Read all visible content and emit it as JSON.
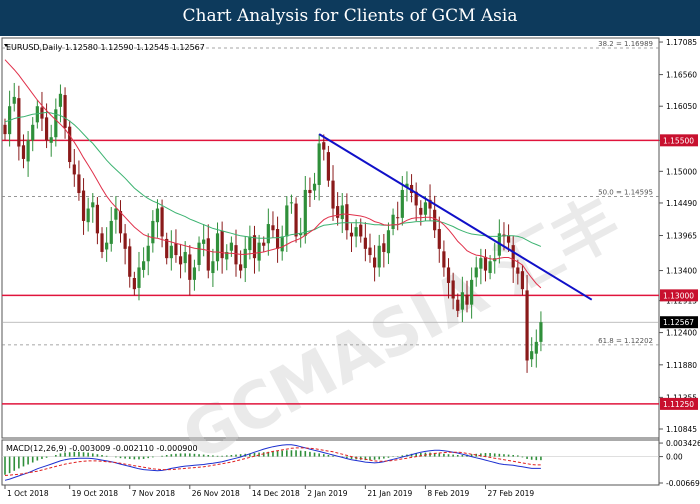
{
  "header": {
    "title": "Chart Analysis for Clients of GCM Asia"
  },
  "chart_data": {
    "type": "candlestick",
    "symbol_info": "EURUSD,Daily  1.12580 1.12590 1.12545 1.12567",
    "price_axis": {
      "ylim": [
        1.107,
        1.1715
      ],
      "ticks": [
        "1.17085",
        "1.16560",
        "1.16050",
        "1.15500",
        "1.15000",
        "1.14490",
        "1.13965",
        "1.13400",
        "1.12915",
        "1.12400",
        "1.11880",
        "1.11355",
        "1.10845"
      ]
    },
    "x_axis": {
      "labels": [
        {
          "label": "1 Oct 2018",
          "bar": 0
        },
        {
          "label": "19 Oct 2018",
          "bar": 14
        },
        {
          "label": "7 Nov 2018",
          "bar": 27
        },
        {
          "label": "26 Nov 2018",
          "bar": 40
        },
        {
          "label": "14 Dec 2018",
          "bar": 53
        },
        {
          "label": "2 Jan 2019",
          "bar": 65
        },
        {
          "label": "21 Jan 2019",
          "bar": 78
        },
        {
          "label": "8 Feb 2019",
          "bar": 91
        },
        {
          "label": "27 Feb 2019",
          "bar": 104
        }
      ]
    },
    "fib_levels": [
      {
        "label": "38.2 = 1.16989",
        "price": 1.16989
      },
      {
        "label": "50.0 = 1.14595",
        "price": 1.14595
      },
      {
        "label": "61.8 = 1.12202",
        "price": 1.12202
      }
    ],
    "horizontal_levels": [
      {
        "label": "1.15500",
        "price": 1.155
      },
      {
        "label": "1.13000",
        "price": 1.13
      },
      {
        "label": "1.11250",
        "price": 1.1125
      }
    ],
    "current_price": {
      "label": "1.12567",
      "price": 1.12567
    },
    "trendline": {
      "from": {
        "bar": 68,
        "price": 1.156
      },
      "to": {
        "bar": 127,
        "price": 1.1293
      }
    },
    "close": [
      1.156,
      1.1605,
      1.162,
      1.154,
      1.152,
      1.155,
      1.1575,
      1.1605,
      1.1585,
      1.155,
      1.1555,
      1.16,
      1.1625,
      1.157,
      1.1515,
      1.1495,
      1.1465,
      1.142,
      1.144,
      1.145,
      1.14,
      1.137,
      1.1385,
      1.142,
      1.144,
      1.14,
      1.1375,
      1.133,
      1.131,
      1.1345,
      1.1355,
      1.138,
      1.142,
      1.144,
      1.1395,
      1.136,
      1.138,
      1.1365,
      1.135,
      1.137,
      1.1325,
      1.1345,
      1.1385,
      1.139,
      1.134,
      1.1355,
      1.14,
      1.136,
      1.137,
      1.1385,
      1.135,
      1.134,
      1.1375,
      1.1395,
      1.136,
      1.1385,
      1.138,
      1.1415,
      1.1405,
      1.1375,
      1.1395,
      1.1445,
      1.145,
      1.1395,
      1.14,
      1.147,
      1.1465,
      1.148,
      1.1545,
      1.1535,
      1.1485,
      1.144,
      1.1425,
      1.1445,
      1.1405,
      1.1395,
      1.141,
      1.1395,
      1.1375,
      1.1365,
      1.1345,
      1.138,
      1.137,
      1.1405,
      1.143,
      1.1425,
      1.147,
      1.148,
      1.1465,
      1.1445,
      1.143,
      1.145,
      1.144,
      1.1405,
      1.1375,
      1.1345,
      1.132,
      1.1295,
      1.1275,
      1.1305,
      1.1285,
      1.1325,
      1.1345,
      1.136,
      1.134,
      1.1355,
      1.136,
      1.14,
      1.1395,
      1.1385,
      1.1345,
      1.1335,
      1.131,
      1.1195,
      1.121,
      1.1225,
      1.12567
    ],
    "ma_red": [
      1.168,
      1.1672,
      1.1664,
      1.1655,
      1.1645,
      1.1635,
      1.1625,
      1.1615,
      1.1606,
      1.1598,
      1.159,
      1.1583,
      1.1576,
      1.1568,
      1.1558,
      1.1547,
      1.1535,
      1.1522,
      1.151,
      1.1498,
      1.1485,
      1.1472,
      1.146,
      1.145,
      1.1442,
      1.1434,
      1.1426,
      1.1418,
      1.141,
      1.1404,
      1.1398,
      1.1395,
      1.1393,
      1.1392,
      1.139,
      1.1388,
      1.1386,
      1.1384,
      1.1382,
      1.138,
      1.1378,
      1.1376,
      1.1375,
      1.1374,
      1.1372,
      1.137,
      1.137,
      1.1369,
      1.1368,
      1.1368,
      1.1367,
      1.1366,
      1.1366,
      1.1367,
      1.1368,
      1.1369,
      1.137,
      1.1372,
      1.1374,
      1.1376,
      1.1378,
      1.1382,
      1.1386,
      1.1389,
      1.1392,
      1.1397,
      1.1402,
      1.1407,
      1.1415,
      1.1422,
      1.1426,
      1.1428,
      1.1429,
      1.1431,
      1.1431,
      1.143,
      1.1429,
      1.1428,
      1.1426,
      1.1423,
      1.1419,
      1.1417,
      1.1414,
      1.1413,
      1.1414,
      1.1414,
      1.1417,
      1.1421,
      1.1424,
      1.1425,
      1.1425,
      1.1426,
      1.1426,
      1.1424,
      1.142,
      1.1414,
      1.1406,
      1.1397,
      1.1387,
      1.138,
      1.1372,
      1.1368,
      1.1365,
      1.1364,
      1.1361,
      1.1359,
      1.1358,
      1.136,
      1.1361,
      1.1361,
      1.1358,
      1.1354,
      1.1349,
      1.1338,
      1.1328,
      1.1319,
      1.1312
    ],
    "ma_green": [
      1.158,
      1.1582,
      1.1585,
      1.1587,
      1.1588,
      1.159,
      1.1592,
      1.1593,
      1.1594,
      1.1595,
      1.1594,
      1.1592,
      1.159,
      1.1586,
      1.1581,
      1.1575,
      1.1568,
      1.156,
      1.1552,
      1.1545,
      1.1536,
      1.1527,
      1.1518,
      1.151,
      1.1503,
      1.1496,
      1.1489,
      1.1481,
      1.1473,
      1.1467,
      1.1461,
      1.1456,
      1.1452,
      1.1449,
      1.1445,
      1.1441,
      1.1437,
      1.1433,
      1.143,
      1.1427,
      1.1423,
      1.142,
      1.1417,
      1.1414,
      1.1411,
      1.1408,
      1.1406,
      1.1404,
      1.1402,
      1.14,
      1.1398,
      1.1396,
      1.1395,
      1.1394,
      1.1393,
      1.1392,
      1.1392,
      1.1392,
      1.1393,
      1.1393,
      1.1394,
      1.1396,
      1.1398,
      1.1399,
      1.14,
      1.1402,
      1.1404,
      1.1406,
      1.141,
      1.1413,
      1.1414,
      1.1415,
      1.1416,
      1.1417,
      1.1417,
      1.1417,
      1.1417,
      1.1417,
      1.1416,
      1.1415,
      1.1414,
      1.1414,
      1.1413,
      1.1413,
      1.1414,
      1.1414,
      1.1416,
      1.1417,
      1.1418,
      1.1419,
      1.1419,
      1.142,
      1.142,
      1.142,
      1.1419,
      1.1417,
      1.1414,
      1.1411,
      1.1407,
      1.1404,
      1.1401,
      1.1399,
      1.1398,
      1.1397,
      1.1396,
      1.1395,
      1.1395,
      1.1395,
      1.1396,
      1.1396,
      1.1396,
      1.1395,
      1.1393,
      1.1389,
      1.1385,
      1.1382,
      1.1379
    ],
    "macd": {
      "label": "MACD(12,26,9) -0.003009 -0.002110 -0.000900",
      "ylim": [
        -0.0072,
        0.0042
      ],
      "ticks": [
        "0.003426",
        "0.00",
        "-0.006694"
      ],
      "histogram": [
        -0.0046,
        -0.0042,
        -0.0036,
        -0.003,
        -0.0025,
        -0.002,
        -0.0015,
        -0.001,
        -0.0006,
        -0.0003,
        0.0,
        0.0004,
        0.0008,
        0.001,
        0.0011,
        0.0012,
        0.0012,
        0.0011,
        0.001,
        0.0008,
        0.0006,
        0.0004,
        0.0002,
        0.0,
        -0.0002,
        -0.0004,
        -0.0005,
        -0.0006,
        -0.0007,
        -0.0007,
        -0.0006,
        -0.0004,
        -0.0002,
        0.0,
        0.0002,
        0.0004,
        0.0006,
        0.0007,
        0.0008,
        0.0008,
        0.0008,
        0.0007,
        0.0006,
        0.0005,
        0.0004,
        0.0003,
        0.0002,
        0.0002,
        0.0003,
        0.0004,
        0.0005,
        0.0006,
        0.0007,
        0.0008,
        0.0009,
        0.001,
        0.0011,
        0.0012,
        0.0013,
        0.0014,
        0.0015,
        0.0016,
        0.0016,
        0.0016,
        0.0015,
        0.0014,
        0.0012,
        0.001,
        0.0008,
        0.0006,
        0.0004,
        0.0002,
        0.0,
        -0.0002,
        -0.0004,
        -0.0006,
        -0.0007,
        -0.0008,
        -0.0009,
        -0.0009,
        -0.0008,
        -0.0007,
        -0.0005,
        -0.0003,
        -0.0001,
        0.0001,
        0.0003,
        0.0005,
        0.0007,
        0.0008,
        0.0009,
        0.001,
        0.001,
        0.0009,
        0.0008,
        0.0007,
        0.0006,
        0.0005,
        0.0004,
        0.0004,
        0.0005,
        0.0006,
        0.0007,
        0.0008,
        0.0009,
        0.0009,
        0.0008,
        0.0007,
        0.0006,
        0.0005,
        0.0004,
        0.0003,
        -0.0002,
        -0.0006,
        -0.0008,
        -0.0009,
        -0.0009
      ],
      "macd_line": [
        -0.006,
        -0.0057,
        -0.0053,
        -0.0049,
        -0.0045,
        -0.0041,
        -0.0036,
        -0.0031,
        -0.0027,
        -0.0023,
        -0.0019,
        -0.0015,
        -0.0011,
        -0.0008,
        -0.0006,
        -0.0005,
        -0.0004,
        -0.0004,
        -0.0004,
        -0.0005,
        -0.0007,
        -0.0009,
        -0.0011,
        -0.0013,
        -0.0016,
        -0.0019,
        -0.0022,
        -0.0025,
        -0.0028,
        -0.0031,
        -0.0033,
        -0.0034,
        -0.0035,
        -0.0036,
        -0.0035,
        -0.0033,
        -0.003,
        -0.0028,
        -0.0026,
        -0.0024,
        -0.0023,
        -0.0022,
        -0.0021,
        -0.002,
        -0.0018,
        -0.0017,
        -0.0015,
        -0.0013,
        -0.001,
        -0.0007,
        -0.0004,
        -0.0001,
        0.0003,
        0.0007,
        0.0011,
        0.0015,
        0.0019,
        0.0022,
        0.0025,
        0.0027,
        0.0029,
        0.003,
        0.003,
        0.0028,
        0.0025,
        0.0022,
        0.0019,
        0.0016,
        0.0013,
        0.001,
        0.0007,
        0.0004,
        0.0001,
        -0.0002,
        -0.0005,
        -0.0008,
        -0.001,
        -0.0012,
        -0.0014,
        -0.0015,
        -0.0016,
        -0.0015,
        -0.0013,
        -0.001,
        -0.0007,
        -0.0004,
        -0.0001,
        0.0002,
        0.0005,
        0.0008,
        0.0011,
        0.0013,
        0.0015,
        0.0016,
        0.0016,
        0.0015,
        0.0013,
        0.0011,
        0.0009,
        0.0006,
        0.0003,
        0.0,
        -0.0003,
        -0.0006,
        -0.0009,
        -0.0012,
        -0.0015,
        -0.0018,
        -0.002,
        -0.0021,
        -0.0022,
        -0.0024,
        -0.0026,
        -0.0028,
        -0.003,
        -0.003,
        -0.003
      ],
      "signal_line": [
        -0.0048,
        -0.0047,
        -0.0046,
        -0.0045,
        -0.0043,
        -0.0041,
        -0.0039,
        -0.0037,
        -0.0034,
        -0.0031,
        -0.0028,
        -0.0025,
        -0.0022,
        -0.0019,
        -0.0017,
        -0.0015,
        -0.0013,
        -0.0012,
        -0.0011,
        -0.0011,
        -0.0011,
        -0.0012,
        -0.0013,
        -0.0014,
        -0.0015,
        -0.0017,
        -0.0019,
        -0.0021,
        -0.0023,
        -0.0025,
        -0.0027,
        -0.0029,
        -0.0031,
        -0.0032,
        -0.0033,
        -0.0033,
        -0.0033,
        -0.0032,
        -0.0031,
        -0.003,
        -0.0029,
        -0.0028,
        -0.0027,
        -0.0026,
        -0.0024,
        -0.0022,
        -0.002,
        -0.0018,
        -0.0016,
        -0.0014,
        -0.0011,
        -0.0008,
        -0.0005,
        -0.0002,
        0.0001,
        0.0004,
        0.0007,
        0.001,
        0.0013,
        0.0015,
        0.0017,
        0.0019,
        0.0021,
        0.0022,
        0.0022,
        0.0022,
        0.0021,
        0.002,
        0.0018,
        0.0016,
        0.0014,
        0.0012,
        0.0009,
        0.0006,
        0.0003,
        0.0,
        -0.0003,
        -0.0005,
        -0.0007,
        -0.0009,
        -0.0011,
        -0.0012,
        -0.0012,
        -0.0011,
        -0.001,
        -0.0008,
        -0.0006,
        -0.0004,
        -0.0002,
        0.0,
        0.0002,
        0.0004,
        0.0006,
        0.0008,
        0.0009,
        0.001,
        0.0011,
        0.0011,
        0.0011,
        0.001,
        0.0008,
        0.0006,
        0.0004,
        0.0002,
        0.0,
        -0.0002,
        -0.0004,
        -0.0006,
        -0.0008,
        -0.001,
        -0.0012,
        -0.0014,
        -0.0016,
        -0.0018,
        -0.002,
        -0.0021,
        -0.0021
      ]
    }
  },
  "colors": {
    "header_bg": "#0d3a5c",
    "bull": "#2f8f3a",
    "bear": "#8a1a1a",
    "level_line": "#e0143c",
    "level_label_bg": "#c8102e",
    "trendline": "#1010c8",
    "ma_red": "#e0304a",
    "ma_green": "#3cb371",
    "macd_line": "#1c2fd0",
    "signal_line": "#e02020",
    "macd_hist": "#2f8f3a"
  }
}
